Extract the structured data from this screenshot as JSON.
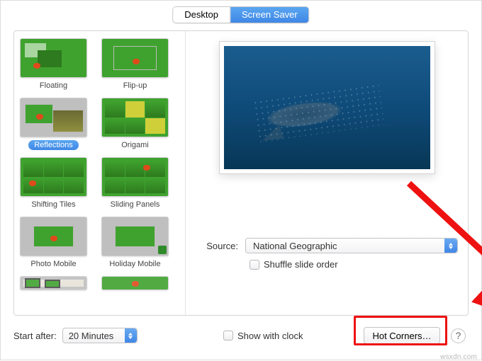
{
  "tabs": {
    "desktop": "Desktop",
    "screensaver": "Screen Saver"
  },
  "screensavers": [
    {
      "name": "Floating"
    },
    {
      "name": "Flip-up"
    },
    {
      "name": "Reflections",
      "selected": true
    },
    {
      "name": "Origami"
    },
    {
      "name": "Shifting Tiles"
    },
    {
      "name": "Sliding Panels"
    },
    {
      "name": "Photo Mobile"
    },
    {
      "name": "Holiday Mobile"
    }
  ],
  "source": {
    "label": "Source:",
    "value": "National Geographic"
  },
  "shuffle": {
    "label": "Shuffle slide order",
    "checked": false
  },
  "start_after": {
    "label": "Start after:",
    "value": "20 Minutes"
  },
  "show_with_clock": {
    "label": "Show with clock",
    "checked": false
  },
  "hot_corners": "Hot Corners…",
  "help_glyph": "?",
  "watermark": "wsxdn.com",
  "colors": {
    "accent": "#3f87e6",
    "annotation": "#e11"
  }
}
